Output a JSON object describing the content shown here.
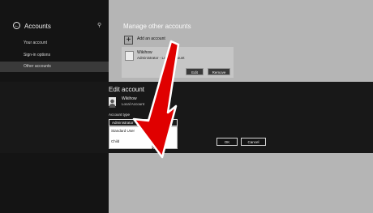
{
  "sidebar": {
    "title": "Accounts",
    "items": [
      {
        "label": "Your account"
      },
      {
        "label": "Sign-in options"
      },
      {
        "label": "Other accounts"
      }
    ]
  },
  "manage": {
    "title": "Manage other accounts",
    "add_label": "Add an account",
    "account": {
      "name": "Wikihow",
      "type": "Administrator - Local Account",
      "edit_label": "Edit",
      "remove_label": "Remove"
    }
  },
  "edit_dialog": {
    "title": "Edit account",
    "account_name": "Wikihow",
    "account_type": "Local Account",
    "type_label": "Account type",
    "selected": "Administrator",
    "options": [
      "Standard User",
      "Child"
    ],
    "ok_label": "OK",
    "cancel_label": "Cancel"
  },
  "colors": {
    "arrow": "#e00000",
    "arrow_outline": "#ffffff"
  }
}
